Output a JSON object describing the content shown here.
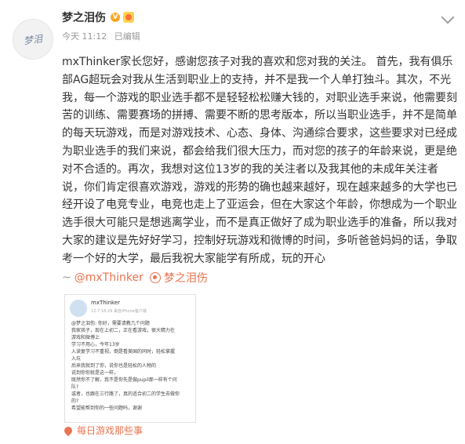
{
  "post": {
    "author": "梦之泪伤",
    "vip_badge": "V",
    "time": "今天 11:12",
    "edited": "已编辑",
    "text": "mxThinker家长您好，感谢您孩子对我的喜欢和您对我的关注。 首先，我有俱乐部AG超玩会对我从生活到职业上的支持，并不是我一个人单打独斗。其次，不光我，每一个游戏的职业选手都不是轻轻松松赚大钱的，对职业选手来说，他需要刻苦的训练、需要赛场的拼搏、需要不断的思考版本，所以当职业选手，并不是简单的每天玩游戏，而是对游戏技术、心态、身体、沟通综合要求，这些要求对已经成为职业选手的我们来说，都会给我们很大压力，而对您的孩子的年龄来说，更是绝对不合适的。再次，我想对这位13岁的我的关注者以及我其他的未成年关注者说，你们肯定很喜欢游戏，游戏的形势的确也越来越好，现在越来越多的大学也已经开设了电竞专业，电竞也走上了亚运会，但在大家这个年龄，你想成为一个职业选手很大可能只是想逃离学业，而不是真正做好了成为职业选手的准备，所以我对大家的建议是先好好学习，控制好玩游戏和微博的时间，多听爸爸妈妈的话，争取考一个好的大学，最后我祝大家能学有所成，玩的开心",
    "repost_prefix": "~",
    "mention": "@mxThinker",
    "author_link": "梦之泪伤"
  },
  "thumbnail": {
    "name": "mxThinker",
    "meta": "12-7 18:29 来自iPhone客户端",
    "lines": [
      "@梦之泪伤: 你好，需要请教几个问题",
      "我家孩子，现在上初二，正在看游戏，很大精力在",
      "游戏和微博上",
      "学习不用心，今年13岁",
      "入读复学习不重视，倒是看美国的同时，轻松掌握",
      "入坑",
      "后来我就到了你，说你也是轻松的人物的",
      "说到你你就是这一样，",
      "既然你不了解，我不是你先是做pupil那一样有个问",
      "队?",
      "或者，也跟在三行路了，真的适合初二的学生去做你",
      "的?",
      "希望能帮到你的一些问题吗，谢谢"
    ]
  },
  "topic_tag": "每日游戏那些事"
}
